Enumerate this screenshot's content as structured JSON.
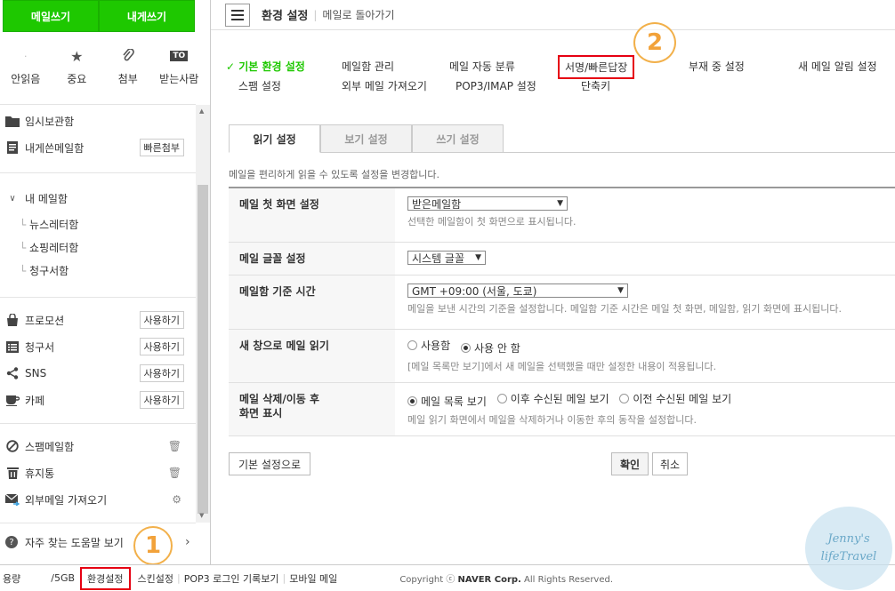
{
  "sidebar": {
    "write_mail": "메일쓰기",
    "write_self": "내게쓰기",
    "quick": [
      {
        "icon": "envelope-unread-icon",
        "label": "안읽음"
      },
      {
        "icon": "star-icon",
        "label": "중요"
      },
      {
        "icon": "paperclip-icon",
        "label": "첨부"
      },
      {
        "icon": "to-icon",
        "icon_text": "TO",
        "label": "받는사람"
      }
    ],
    "folders": [
      {
        "label": "임시보관함"
      },
      {
        "label": "내게쓴메일함",
        "tag": "빠른첨부"
      }
    ],
    "my_mailbox": "내 메일함",
    "sub_folders": [
      "뉴스레터함",
      "쇼핑레터함",
      "청구서함"
    ],
    "services": [
      {
        "label": "프로모션",
        "tag": "사용하기"
      },
      {
        "label": "청구서",
        "tag": "사용하기"
      },
      {
        "label": "SNS",
        "tag": "사용하기"
      },
      {
        "label": "카페",
        "tag": "사용하기"
      }
    ],
    "utility": [
      {
        "label": "스팸메일함"
      },
      {
        "label": "휴지통"
      },
      {
        "label": "외부메일 가져오기"
      }
    ],
    "help": "자주 찾는 도움말 보기"
  },
  "annotations": {
    "one": "1",
    "two": "2"
  },
  "footer": {
    "capacity": "용량",
    "size": "/5GB",
    "settings": "환경설정",
    "skin": "스킨설정",
    "pop3_log": "POP3 로그인 기록보기",
    "mobile": "모바일 메일",
    "copyright_prefix": "Copyright ⓒ ",
    "copyright_brand": "NAVER Corp.",
    "copyright_suffix": " All Rights Reserved."
  },
  "topbar": {
    "title": "환경 설정",
    "back": "메일로 돌아가기"
  },
  "nav": {
    "basic": "✓ 기본 환경 설정",
    "mailbox": "메일함 관리",
    "auto_sort": "메일 자동 분류",
    "signature": "서명/빠른답장",
    "away": "부재 중 설정",
    "alert": "새 메일 알림 설정",
    "spam": "스팸 설정",
    "external": "외부 메일 가져오기",
    "pop3": "POP3/IMAP 설정",
    "shortcut": "단축키"
  },
  "tabs": {
    "read": "읽기 설정",
    "view": "보기 설정",
    "write": "쓰기 설정"
  },
  "settings_desc": "메일을 편리하게 읽을 수 있도록 설정을 변경합니다.",
  "rows": {
    "first_screen": {
      "label": "메일 첫 화면 설정",
      "value": "받은메일함",
      "hint": "선택한 메일함이 첫 화면으로 표시됩니다."
    },
    "font": {
      "label": "메일 글꼴 설정",
      "value": "시스템 글꼴"
    },
    "timezone": {
      "label": "메일함 기준 시간",
      "value": "GMT +09:00 (서울, 도쿄)",
      "hint": "메일을 보낸 시간의 기준을 설정합니다. 메일함 기준 시간은 메일 첫 화면, 메일함, 읽기 화면에 표시됩니다."
    },
    "new_window": {
      "label": "새 창으로 메일 읽기",
      "opt_use": "사용함",
      "opt_no": "사용 안 함",
      "hint": "[메일 목록만 보기]에서 새 메일을 선택했을 때만 설정한 내용이 적용됩니다."
    },
    "after_delete": {
      "label_1": "메일 삭제/이동 후",
      "label_2": "화면 표시",
      "opt_list": "메일 목록 보기",
      "opt_next": "이후 수신된 메일 보기",
      "opt_prev": "이전 수신된 메일 보기",
      "hint": "메일 읽기 화면에서 메일을 삭제하거나 이동한 후의 동작을 설정합니다."
    }
  },
  "buttons": {
    "reset": "기본 설정으로",
    "ok": "확인",
    "cancel": "취소"
  },
  "watermark": {
    "line1": "Jenny's",
    "line2": "lifeTravel"
  },
  "colors": {
    "accent_green": "#1ec800",
    "highlight_red": "#e60012",
    "annotation_orange": "#f2a23a"
  }
}
